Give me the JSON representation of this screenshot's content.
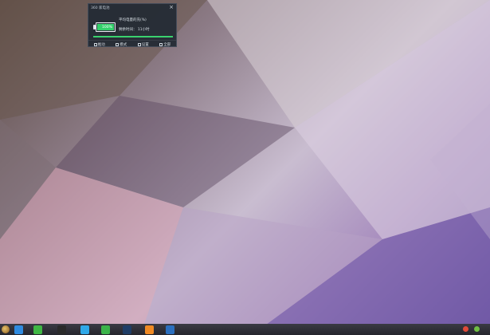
{
  "battery_widget": {
    "title": "360 家电池",
    "close_icon": "close-icon",
    "percent_label": "100%",
    "status_line": "平均电量的充(%)",
    "time_line": "剩余时间： 11小时",
    "progress": 1.0,
    "actions": [
      {
        "label": "推动",
        "icon": "plug-icon"
      },
      {
        "label": "模式",
        "icon": "mode-icon"
      },
      {
        "label": "设置",
        "icon": "settings-icon"
      },
      {
        "label": "全部",
        "icon": "list-icon"
      }
    ]
  },
  "taskbar": {
    "start_icon": "start-orb-icon",
    "apps": [
      {
        "name": "browser",
        "color": "#2f8be0"
      },
      {
        "name": "wechat",
        "color": "#3fb744"
      },
      {
        "name": "qq",
        "color": "#2a2a2a"
      },
      {
        "name": "sogou",
        "color": "#2fa8e8"
      },
      {
        "name": "spreadsheet",
        "color": "#3bb34a"
      },
      {
        "name": "photoshop",
        "color": "#1f3d66"
      },
      {
        "name": "messaging",
        "color": "#f08a24"
      },
      {
        "name": "word",
        "color": "#2b6fbf"
      }
    ],
    "tray": [
      {
        "name": "security",
        "color": "#e04a3a"
      },
      {
        "name": "network",
        "color": "#6fbe44"
      }
    ]
  },
  "colors": {
    "widget_bg": "#232a34",
    "battery_green": "#33d06b",
    "taskbar_bg": "#2e2e36"
  }
}
